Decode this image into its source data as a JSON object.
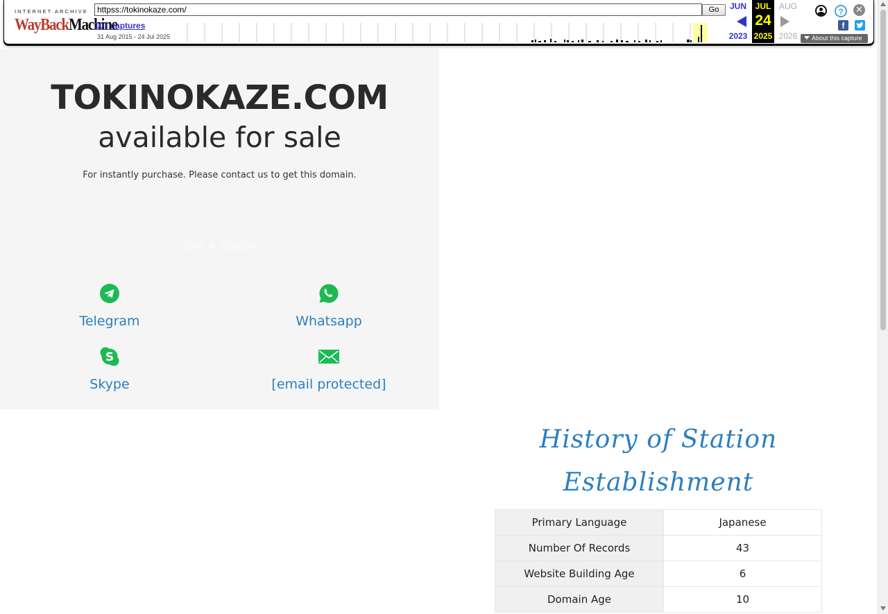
{
  "wayback": {
    "logo_top": "INTERNET ARCHIVE",
    "logo_wayback": "WayBack",
    "logo_machine": "Machine",
    "url": "httpss://tokinokaze.com/",
    "go_label": "Go",
    "captures_label": "107 captures",
    "date_range": "31 Aug 2015 - 24 Jul 2025",
    "prev_month": "JUN",
    "prev_year": "2023",
    "current_month": "JUL",
    "current_day": "24",
    "current_year": "2025",
    "next_month": "AUG",
    "next_year": "2026",
    "about_label": "About this capture",
    "icons": [
      "user-icon",
      "help-icon",
      "close-icon",
      "facebook-icon",
      "twitter-icon"
    ]
  },
  "hero": {
    "domain": "TOKINOKAZE.COM",
    "subtitle": "available for sale",
    "description": "For instantly purchase. Please contact us to get this domain.",
    "quote_button": "Get A Quote"
  },
  "contacts": {
    "telegram": "Telegram",
    "whatsapp": "Whatsapp",
    "skype": "Skype",
    "email": "[email protected]",
    "icon_color": "#1db954"
  },
  "history": {
    "title": "History of Station Establishment",
    "rows": [
      {
        "key": "Primary Language",
        "value": "Japanese"
      },
      {
        "key": "Number Of Records",
        "value": "43"
      },
      {
        "key": "Website Building Age",
        "value": "6"
      },
      {
        "key": "Domain Age",
        "value": "10"
      }
    ]
  },
  "colors": {
    "accent_blue": "#2a7fc1",
    "panel_bg": "#f5f5f5",
    "icon_green": "#1db954"
  }
}
